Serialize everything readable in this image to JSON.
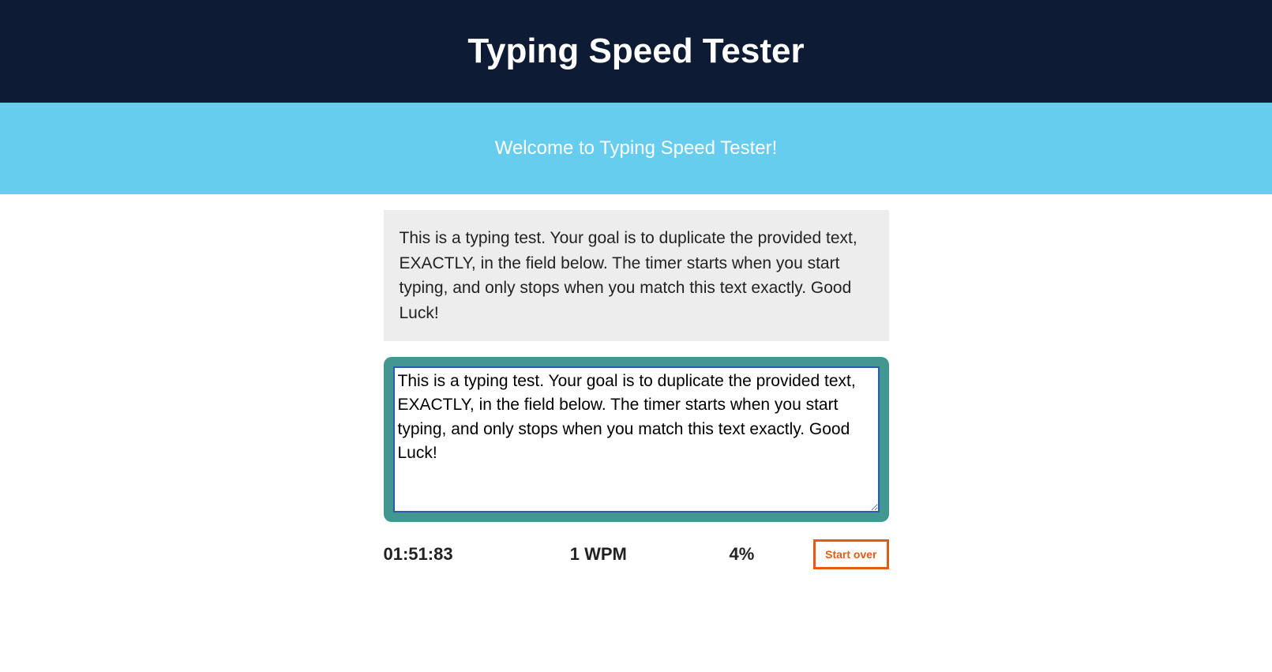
{
  "header": {
    "title": "Typing Speed Tester"
  },
  "welcome": {
    "message": "Welcome to Typing Speed Tester!"
  },
  "instructions": {
    "text": "This is a typing test. Your goal is to duplicate the provided text, EXACTLY, in the field below. The timer starts when you start typing, and only stops when you match this text exactly. Good Luck!"
  },
  "typing": {
    "value": "This is a typing test. Your goal is to duplicate the provided text, EXACTLY, in the field below. The timer starts when you start typing, and only stops when you match this text exactly. Good Luck!"
  },
  "stats": {
    "timer": "01:51:83",
    "wpm": "1 WPM",
    "accuracy": "4%",
    "start_over_label": "Start over"
  }
}
